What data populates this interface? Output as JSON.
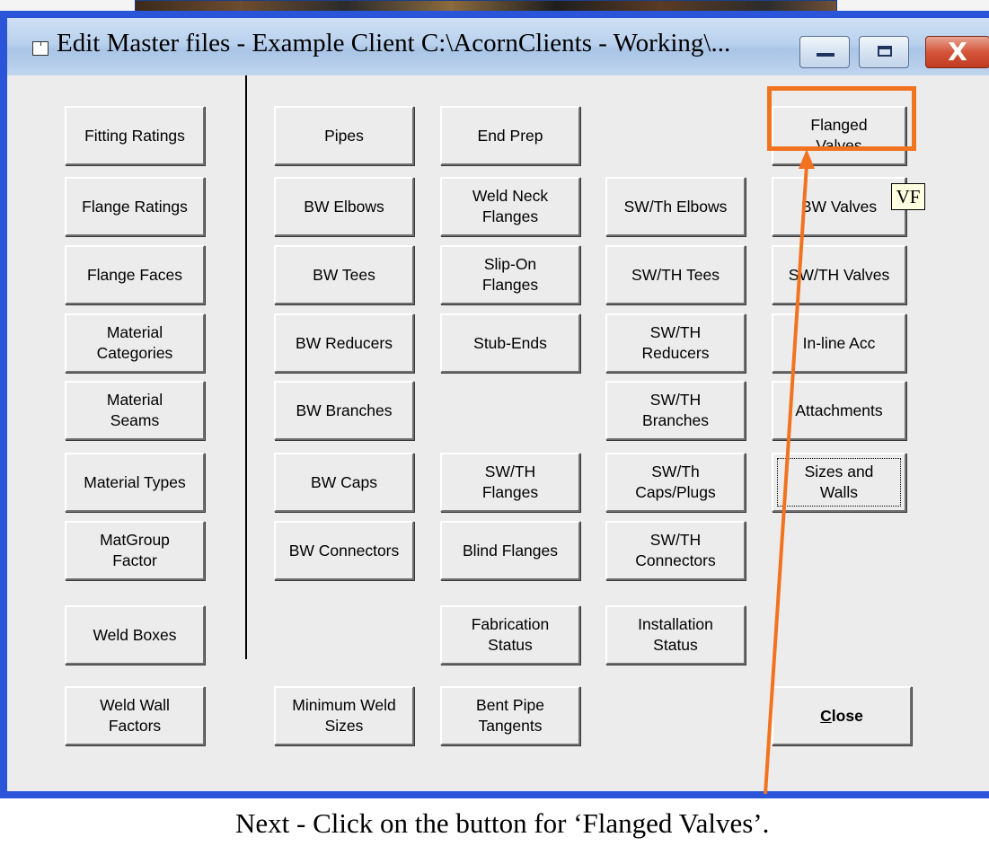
{
  "window": {
    "title": "Edit Master files - Example Client   C:\\AcornClients - Working\\...",
    "minimize_icon": "minimize-icon",
    "maximize_icon": "maximize-icon",
    "close_icon": "close-icon",
    "close_glyph": "X"
  },
  "buttons": {
    "fitting_ratings": "Fitting Ratings",
    "flange_ratings": "Flange Ratings",
    "flange_faces": "Flange Faces",
    "material_categories": "Material\nCategories",
    "material_seams": "Material\nSeams",
    "material_types": "Material Types",
    "matgroup_factor": "MatGroup\nFactor",
    "weld_boxes": "Weld Boxes",
    "weld_wall_factors": "Weld Wall\nFactors",
    "pipes": "Pipes",
    "bw_elbows": "BW Elbows",
    "bw_tees": "BW Tees",
    "bw_reducers": "BW Reducers",
    "bw_branches": "BW Branches",
    "bw_caps": "BW Caps",
    "bw_connectors": "BW Connectors",
    "minimum_weld_sizes": "Minimum Weld\nSizes",
    "end_prep": "End Prep",
    "weld_neck_flanges": "Weld Neck\nFlanges",
    "slip_on_flanges": "Slip-On\nFlanges",
    "stub_ends": "Stub-Ends",
    "sw_th_flanges": "SW/TH\nFlanges",
    "blind_flanges": "Blind Flanges",
    "fabrication_status": "Fabrication\nStatus",
    "bent_pipe_tangents": "Bent Pipe\nTangents",
    "sw_th_elbows": "SW/Th Elbows",
    "sw_th_tees": "SW/TH Tees",
    "sw_th_reducers": "SW/TH\nReducers",
    "sw_th_branches": "SW/TH\nBranches",
    "sw_th_caps_plugs": "SW/Th\nCaps/Plugs",
    "sw_th_connectors": "SW/TH\nConnectors",
    "installation_status": "Installation\nStatus",
    "flanged_valves": "Flanged\nValves",
    "bw_valves": "BW Valves",
    "sw_th_valves": "SW/TH Valves",
    "inline_acc": "In-line Acc",
    "attachments": "Attachments",
    "sizes_and_walls": "Sizes and\nWalls",
    "close_mnemonic": "C",
    "close_rest": "lose"
  },
  "tooltip": "VF",
  "caption": "Next - Click on the button for ‘Flanged Valves’.",
  "colors": {
    "frame": "#2b55d9",
    "highlight": "#f2731f",
    "arrow": "#f2731f"
  }
}
